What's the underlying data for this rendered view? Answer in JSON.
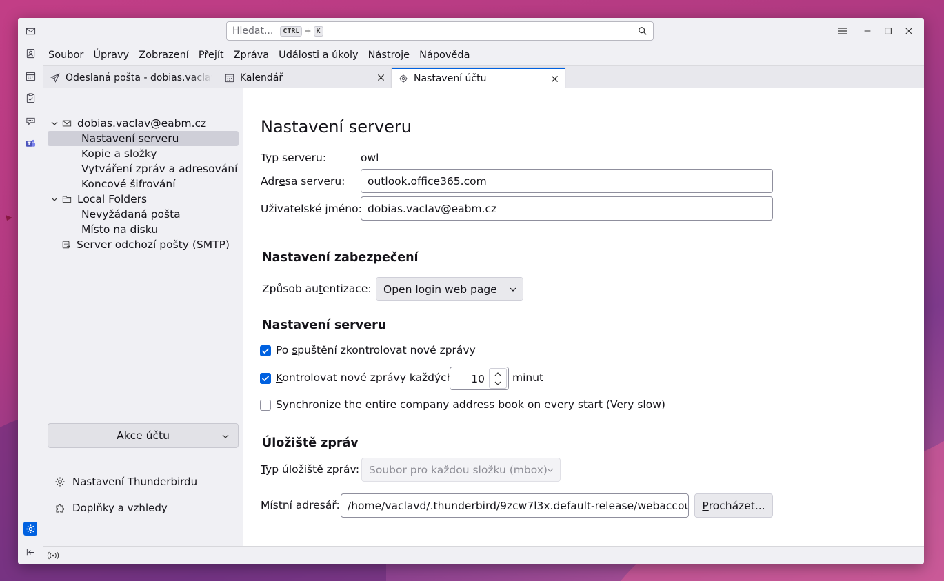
{
  "search": {
    "placeholder": "Hledat...",
    "shortcut_key1": "CTRL",
    "shortcut_plus": "+",
    "shortcut_key2": "K"
  },
  "menu": [
    {
      "pre": "",
      "acc": "S",
      "post": "oubor"
    },
    {
      "pre": "Úp",
      "acc": "r",
      "post": "avy"
    },
    {
      "pre": "",
      "acc": "Z",
      "post": "obrazení"
    },
    {
      "pre": "",
      "acc": "P",
      "post": "řejít"
    },
    {
      "pre": "Zp",
      "acc": "r",
      "post": "áva"
    },
    {
      "pre": "",
      "acc": "U",
      "post": "dálosti a úkoly"
    },
    {
      "pre": "",
      "acc": "N",
      "post": "ástroje"
    },
    {
      "pre": "",
      "acc": "N",
      "post": "ápověda"
    }
  ],
  "tabs": [
    {
      "label": "Odeslaná pošta - dobias.vaclav@eabm.cz",
      "icon": "send-icon"
    },
    {
      "label": "Kalendář",
      "icon": "calendar-icon"
    },
    {
      "label": "Nastavení účtu",
      "icon": "account-settings-icon"
    }
  ],
  "tree": {
    "account": "dobias.vaclav@eabm.cz",
    "account_items": [
      "Nastavení serveru",
      "Kopie a složky",
      "Vytváření zpráv a adresování",
      "Koncové šifrování"
    ],
    "local": "Local Folders",
    "local_items": [
      "Nevyžádaná pošta",
      "Místo na disku"
    ],
    "smtp": "Server odchozí pošty (SMTP)"
  },
  "sidebar": {
    "account_actions": {
      "pre": "",
      "acc": "A",
      "post": "kce účtu"
    },
    "thunderbird_settings": "Nastavení Thunderbirdu",
    "addons": "Doplňky a vzhledy"
  },
  "main": {
    "title": "Nastavení serveru",
    "server_type_label": "Typ serveru:",
    "server_type_value": "owl",
    "server_address_label": {
      "pre": "Adr",
      "acc": "e",
      "post": "sa serveru:"
    },
    "server_address_value": "outlook.office365.com",
    "username_label": "Uživatelské jméno:",
    "username_value": "dobias.vaclav@eabm.cz",
    "security_heading": "Nastavení zabezpečení",
    "auth_label": {
      "pre": "Způsob au",
      "acc": "t",
      "post": "entizace:"
    },
    "auth_value": "Open login web page",
    "server_heading": "Nastavení serveru",
    "check_startup": {
      "pre": "Po ",
      "acc": "s",
      "post": "puštění zkontrolovat nové zprávy",
      "checked": true
    },
    "check_every": {
      "pre": "",
      "acc": "K",
      "post": "ontrolovat nové zprávy každých",
      "checked": true
    },
    "check_every_value": "10",
    "check_every_unit": "minut",
    "sync_addressbook": {
      "label": "Synchronize the entire company address book on every start (Very slow)",
      "checked": false
    },
    "storage_heading": "Úložiště zpráv",
    "storage_type_label": {
      "pre": "",
      "acc": "T",
      "post": "yp úložiště zpráv:"
    },
    "storage_type_value": "Soubor pro každou složku (mbox)",
    "local_dir_label": "Místní adresář:",
    "local_dir_value": "/home/vaclavd/.thunderbird/9zcw7l3x.default-release/webaccou",
    "browse_button": {
      "pre": "",
      "acc": "P",
      "post": "rocházet..."
    }
  },
  "colors": {
    "accent": "#0061e0",
    "sidebar_bg": "#f0f0f4",
    "selected_row": "#cfcfd8"
  }
}
